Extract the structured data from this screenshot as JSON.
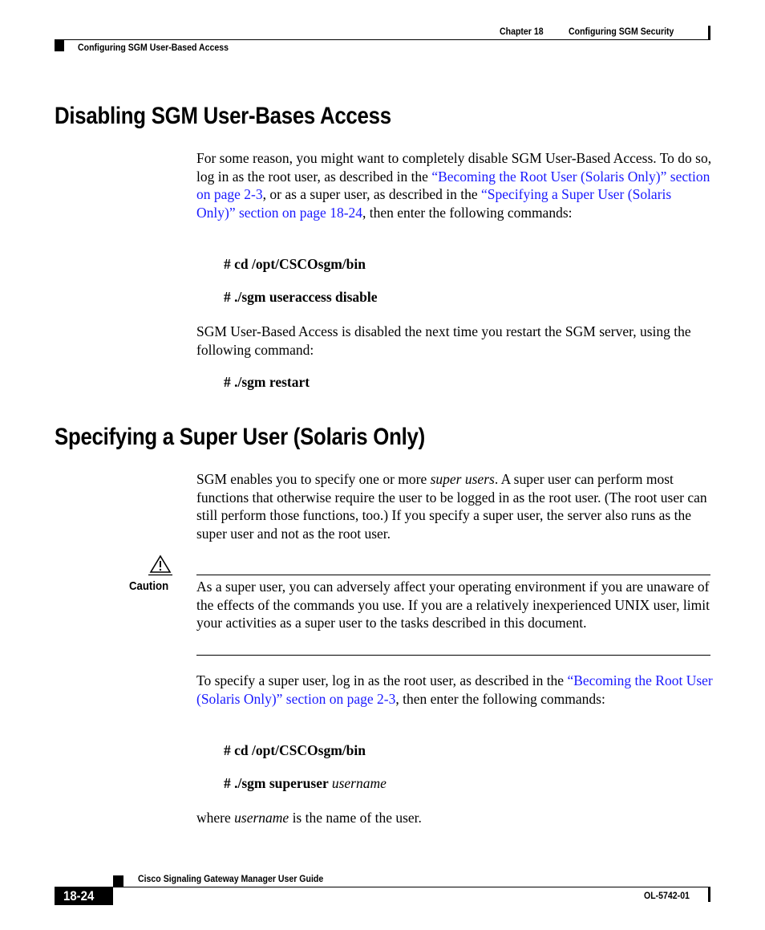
{
  "header": {
    "chapter": "Chapter 18",
    "chapter_title": "Configuring SGM Security",
    "section": "Configuring SGM User-Based Access"
  },
  "section1": {
    "title": "Disabling SGM User-Bases Access",
    "intro_1": "For some reason, you might want to completely disable SGM User-Based Access. To do so, log in as the root user, as described in the ",
    "link_1": "“Becoming the Root User (Solaris Only)” section on page 2-3",
    "intro_2": ", or as a super user, as described in the ",
    "link_2": "“Specifying a Super User (Solaris Only)” section on page 18-24",
    "intro_3": ", then enter the following commands:",
    "cmd_1": "# cd /opt/CSCOsgm/bin",
    "cmd_2": "# ./sgm useraccess disable",
    "restart_text": "SGM User-Based Access is disabled the next time you restart the SGM server, using the following command:",
    "cmd_3": "# ./sgm restart"
  },
  "section2": {
    "title": "Specifying a Super User (Solaris Only)",
    "intro_1": "SGM enables you to specify one or more ",
    "intro_em": "super users",
    "intro_2": ". A super user can perform most functions that otherwise require the user to be logged in as the root user. (The root user can still perform those functions, too.) If you specify a super user, the server also runs as the super user and not as the root user.",
    "caution_label": "Caution",
    "caution_text": "As a super user, you can adversely affect your operating environment if you are unaware of the effects of the commands you use. If you are a relatively inexperienced UNIX user, limit your activities as a super user to the tasks described in this document.",
    "specify_1": "To specify a super user, log in as the root user, as described in the ",
    "specify_link": "“Becoming the Root User (Solaris Only)” section on page 2-3",
    "specify_2": ", then enter the following commands:",
    "cmd_1": "# cd /opt/CSCOsgm/bin",
    "cmd_2": "# ./sgm superuser ",
    "cmd_2_arg": "username",
    "where_1": "where ",
    "where_em": "username",
    "where_2": " is the name of the user."
  },
  "footer": {
    "guide_title": "Cisco Signaling Gateway Manager User Guide",
    "page_number": "18-24",
    "doc_id": "OL-5742-01"
  }
}
